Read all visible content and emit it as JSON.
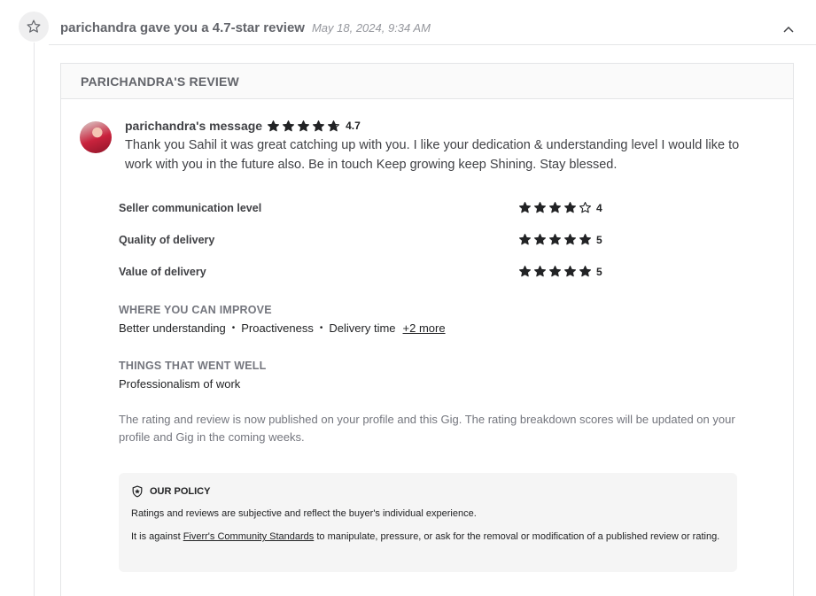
{
  "event": {
    "title": "parichandra gave you a 4.7-star review",
    "date": "May 18, 2024, 9:34 AM"
  },
  "review": {
    "header": "PARICHANDRA'S REVIEW",
    "message_author": "parichandra's message",
    "overall_rating": 4.7,
    "overall_rating_label": "4.7",
    "message": "Thank you Sahil it was great catching up with you. I like your dedication & understanding level I would like to work with you in the future also. Be in touch Keep growing keep Shining. Stay blessed.",
    "breakdown": [
      {
        "label": "Seller communication level",
        "rating": 4,
        "rating_label": "4"
      },
      {
        "label": "Quality of delivery",
        "rating": 5,
        "rating_label": "5"
      },
      {
        "label": "Value of delivery",
        "rating": 5,
        "rating_label": "5"
      }
    ],
    "improve": {
      "title": "WHERE YOU CAN IMPROVE",
      "items": [
        "Better understanding",
        "Proactiveness",
        "Delivery time"
      ],
      "more": "+2 more"
    },
    "went_well": {
      "title": "THINGS THAT WENT WELL",
      "items": [
        "Professionalism of work"
      ]
    },
    "publish_note": "The rating and review is now published on your profile and this Gig. The rating breakdown scores will be updated on your profile and Gig in the coming weeks.",
    "policy": {
      "title": "OUR POLICY",
      "text1": "Ratings and reviews are subjective and reflect the buyer's individual experience.",
      "text2_before": "It is against ",
      "link": "Fiverr's Community Standards",
      "text2_after": " to manipulate, pressure, or ask for the removal or modification of a published review or rating."
    }
  },
  "icons": {
    "event": "star-outline-icon",
    "collapse": "chevron-up-icon",
    "policy": "shield-icon"
  },
  "colors": {
    "star": "#222325",
    "text": "#404145",
    "muted": "#74767e",
    "policy_bg": "#f5f5f5"
  }
}
